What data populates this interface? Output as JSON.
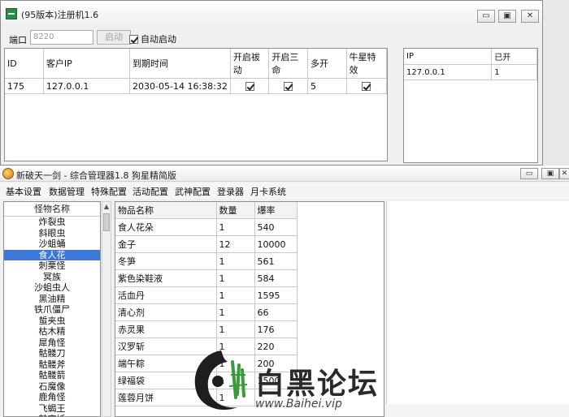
{
  "window1": {
    "title": "(95版本)注册机1.6",
    "controls": {
      "minimize": "▭",
      "restore": "▣",
      "close": "✕"
    },
    "port_label": "端口",
    "port_value": "8220",
    "start_button": "启动",
    "auto_start_label": "自动启动",
    "auto_start_checked": true,
    "table": {
      "columns": [
        "ID",
        "客户IP",
        "到期时间",
        "开启祓动",
        "开启三命",
        "多开",
        "牛星特效"
      ],
      "rows": [
        {
          "id": "175",
          "ip": "127.0.0.1",
          "expire": "2030-05-14 16:38:32",
          "c1": true,
          "c2": true,
          "multi": "5",
          "c3": true
        }
      ]
    },
    "side_table": {
      "columns": [
        "IP",
        "已开"
      ],
      "rows": [
        {
          "ip": "127.0.0.1",
          "count": "1"
        }
      ]
    }
  },
  "window2": {
    "title": "新破天一剑 - 综合管理器1.8 狗星精简版",
    "controls": {
      "minimize": "▭",
      "restore": "▣",
      "close": "✕"
    },
    "menu": [
      "基本设置",
      "数据管理",
      "特殊配置",
      "活动配置",
      "武神配置",
      "登录器",
      "月卡系统"
    ],
    "monster_list": {
      "header": "怪物名称",
      "items": [
        "炸裂虫",
        "斜眼虫",
        "沙蛆蛹",
        "食人花",
        "刺栗怪",
        "冥族",
        "沙蛆虫人",
        "黑油精",
        "铁爪僵尸",
        "蜇夹虫",
        "枯木精",
        "犀角怪",
        "骷髅刀",
        "骷髅斧",
        "骷髅箭",
        "石魔像",
        "鹿角怪",
        "飞蝎王",
        "魅夜妖"
      ],
      "selected_index": 3
    },
    "drop_table": {
      "columns": [
        "物品名称",
        "数量",
        "爆率"
      ],
      "rows": [
        [
          "食人花朵",
          "1",
          "540"
        ],
        [
          "金子",
          "12",
          "10000"
        ],
        [
          "冬笋",
          "1",
          "561"
        ],
        [
          "紫色染鞋液",
          "1",
          "584"
        ],
        [
          "活血丹",
          "1",
          "1595"
        ],
        [
          "清心剂",
          "1",
          "66"
        ],
        [
          "赤灵果",
          "1",
          "176"
        ],
        [
          "汉罗斩",
          "1",
          "220"
        ],
        [
          "端午粽",
          "1",
          "200"
        ],
        [
          "绿福袋",
          "1",
          "1500"
        ],
        [
          "莲蓉月饼",
          "1",
          ""
        ]
      ]
    }
  },
  "watermark": {
    "name": "白黑论坛",
    "url": "www.Baihei.vip"
  }
}
